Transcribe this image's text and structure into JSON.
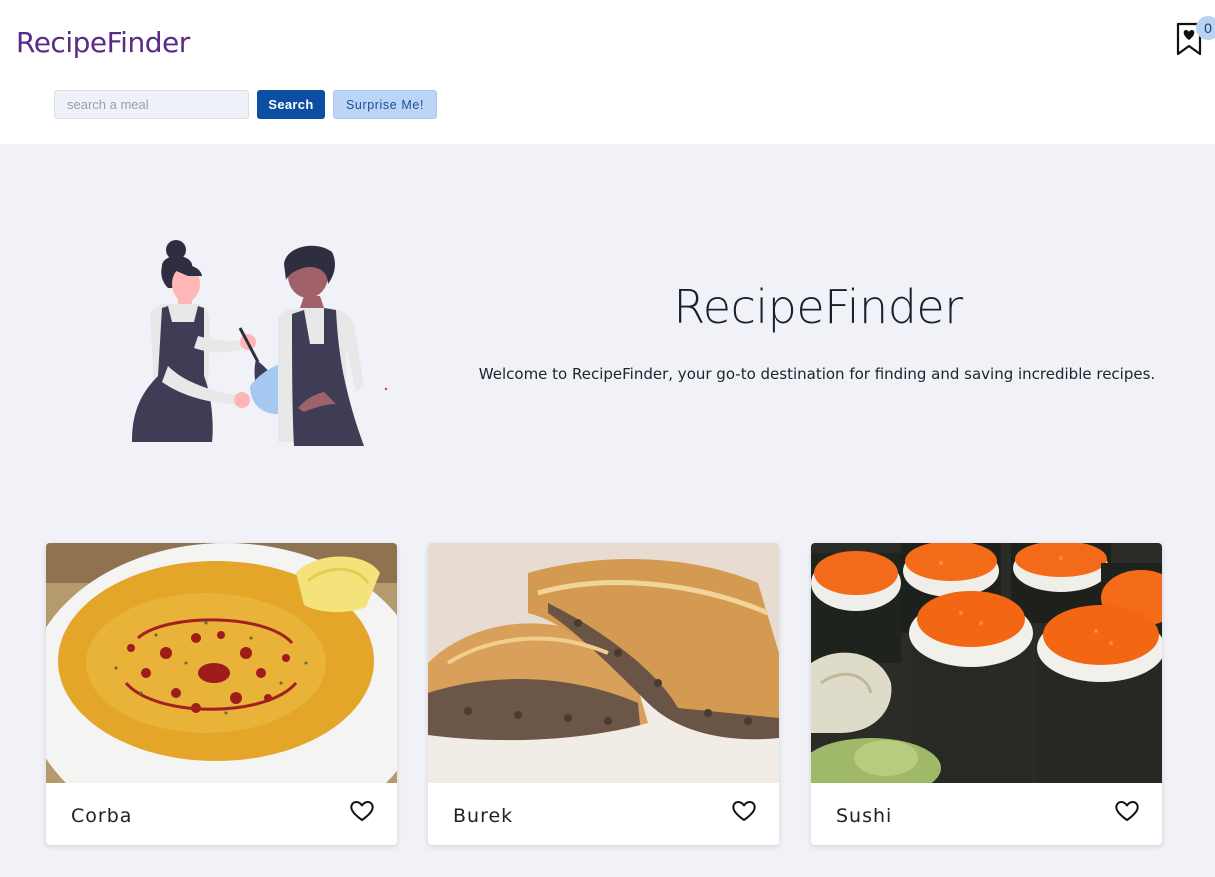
{
  "header": {
    "brand": "RecipeFinder",
    "search_placeholder": "search a meal",
    "search_button": "Search",
    "surprise_button": "Surprise Me!",
    "saved_count": "0",
    "saved_icon": "bookmark-heart-icon"
  },
  "hero": {
    "title": "RecipeFinder",
    "subtitle": "Welcome to RecipeFinder, your go-to destination for finding and saving incredible recipes.",
    "illustration": "two-chefs-cooking-illustration"
  },
  "recipes": [
    {
      "name": "Corba",
      "image": "lentil-soup-photo",
      "favorite_icon": "heart-outline-icon"
    },
    {
      "name": "Burek",
      "image": "burek-pastry-photo",
      "favorite_icon": "heart-outline-icon"
    },
    {
      "name": "Sushi",
      "image": "sushi-rolls-photo",
      "favorite_icon": "heart-outline-icon"
    }
  ],
  "colors": {
    "brand": "#5a2a86",
    "primary_button": "#0b4ea2",
    "secondary_button": "#bcd4f7",
    "page_background": "#f0f2f7"
  }
}
